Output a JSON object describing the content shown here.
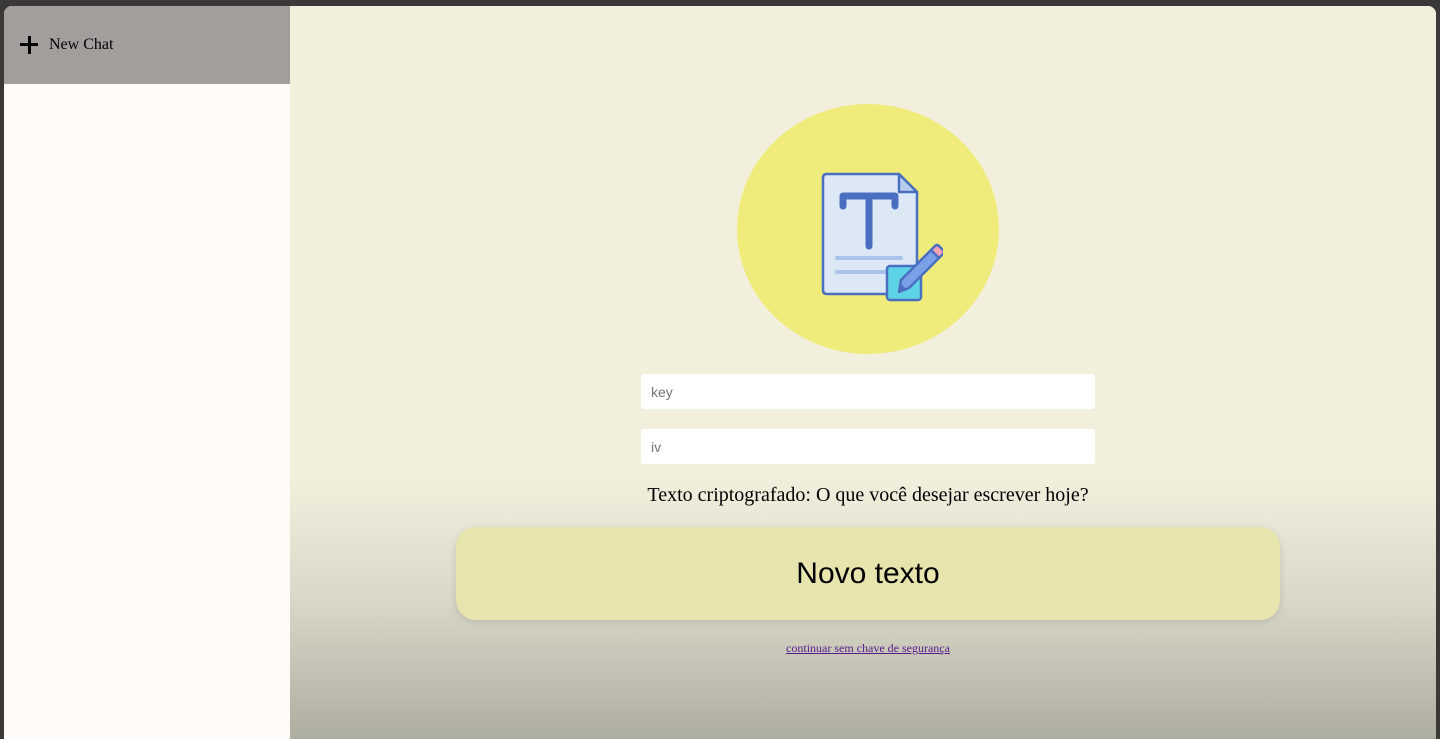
{
  "sidebar": {
    "new_chat_label": "New Chat",
    "new_chat_icon": "plus-icon"
  },
  "main": {
    "hero_icon": "document-edit-icon",
    "key_placeholder": "key",
    "iv_placeholder": "iv",
    "cipher_text": "Texto criptografado: O que você desejar escrever hoje?",
    "new_text_button": "Novo texto",
    "skip_link": "continuar sem chave de segurança"
  },
  "colors": {
    "sidebar_header": "#a29e9b",
    "main_background": "#f2f0dd",
    "hero_circle": "#f0ec7b",
    "button_background": "#e7e5ad",
    "link": "#551a8b"
  }
}
